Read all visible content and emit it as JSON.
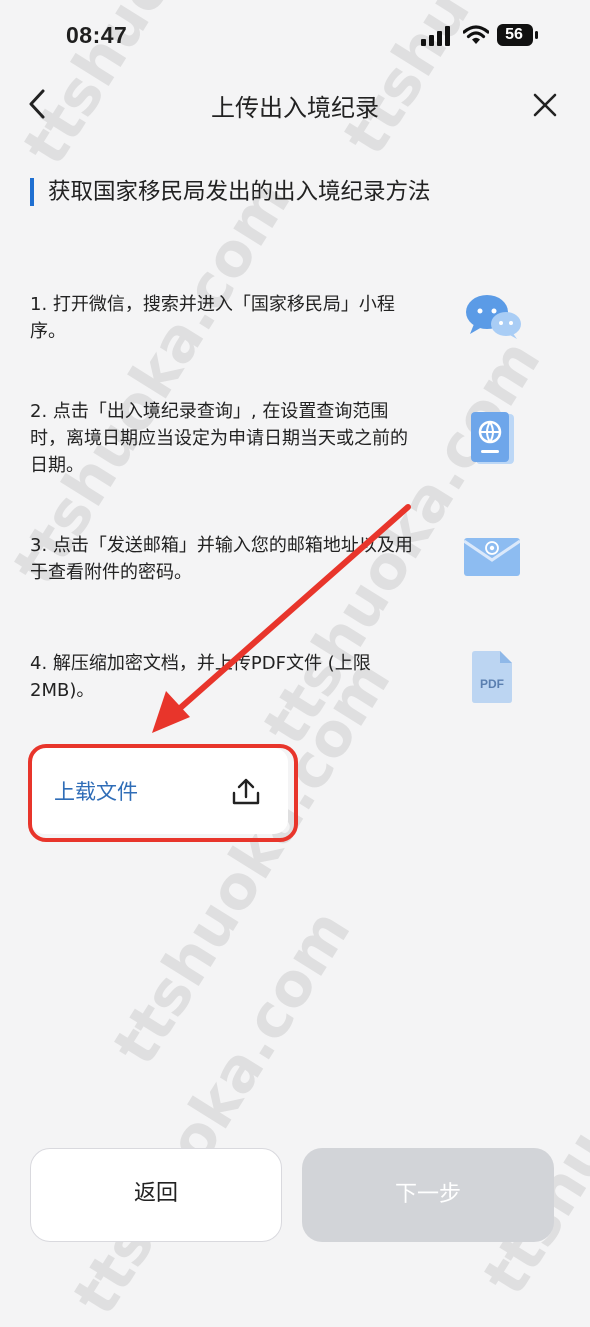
{
  "status_bar": {
    "time": "08:47",
    "battery": "56"
  },
  "nav": {
    "title": "上传出入境纪录"
  },
  "section": {
    "heading": "获取国家移民局发出的出入境纪录方法"
  },
  "steps": [
    {
      "text": "1. 打开微信，搜索并进入「国家移民局」小程序。",
      "icon": "wechat-icon"
    },
    {
      "text": "2. 点击「出入境纪录查询」, 在设置查询范围时，离境日期应当设定为申请日期当天或之前的日期。",
      "icon": "passport-icon"
    },
    {
      "text": "3. 点击「发送邮箱」并输入您的邮箱地址以及用于查看附件的密码。",
      "icon": "email-icon"
    },
    {
      "text": "4. 解压缩加密文档，并上传PDF文件 (上限2MB)。",
      "icon": "pdf-file-icon",
      "icon_text": "PDF"
    }
  ],
  "upload": {
    "label": "上载文件"
  },
  "buttons": {
    "back": "返回",
    "next": "下一步"
  },
  "watermark": "ttshuoka.com",
  "colors": {
    "accent": "#1f6fd1",
    "link": "#2f6db7",
    "highlight": "#e8352b",
    "disabled": "#d2d4d8"
  }
}
